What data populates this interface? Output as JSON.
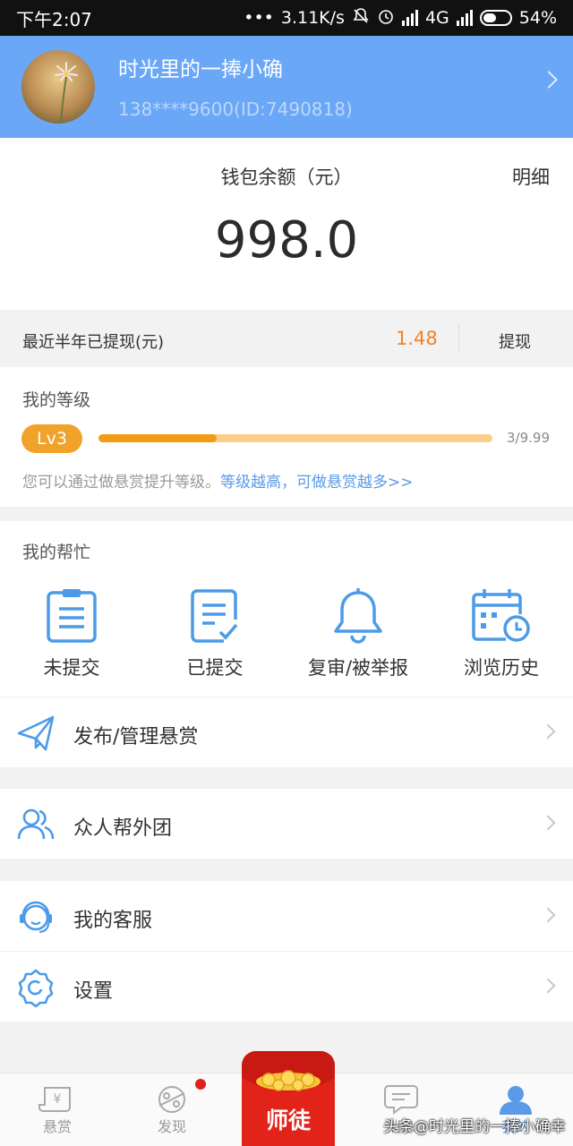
{
  "status_bar": {
    "time": "下午2:07",
    "network_speed": "3.11K/s",
    "network_type": "4G",
    "battery": "54%"
  },
  "profile": {
    "name": "时光里的一捧小确",
    "account": "138****9600(ID:7490818)",
    "header_color": "#6aa7f7"
  },
  "wallet": {
    "title": "钱包余额（元）",
    "detail_label": "明细",
    "balance": "998.0"
  },
  "withdraw": {
    "label": "最近半年已提现(元)",
    "amount": "1.48",
    "button_label": "提现"
  },
  "level": {
    "title": "我的等级",
    "badge": "Lv3",
    "progress_fraction": 0.3,
    "score": "3/9.99",
    "tip_text": "您可以通过做悬赏提升等级。",
    "tip_link": "等级越高，可做悬赏越多>>"
  },
  "help": {
    "title": "我的帮忙",
    "items": [
      {
        "label": "未提交",
        "icon": "clipboard-list-icon"
      },
      {
        "label": "已提交",
        "icon": "clipboard-check-icon"
      },
      {
        "label": "复审/被举报",
        "icon": "bell-icon"
      },
      {
        "label": "浏览历史",
        "icon": "calendar-clock-icon"
      }
    ]
  },
  "menu": {
    "publish": "发布/管理悬赏",
    "team": "众人帮外团",
    "service": "我的客服",
    "settings": "设置"
  },
  "bottom_nav": {
    "items": [
      {
        "label": "悬赏",
        "icon": "reward-scroll-icon"
      },
      {
        "label": "发现",
        "icon": "planet-icon"
      },
      {
        "label": "师徒",
        "icon": "red-packet-icon"
      },
      {
        "label": "消息",
        "icon": "message-icon"
      },
      {
        "label": "我的",
        "icon": "user-icon"
      }
    ],
    "active_color": "#5a9ae8"
  },
  "watermark": "头条@时光里的一捧小确幸"
}
